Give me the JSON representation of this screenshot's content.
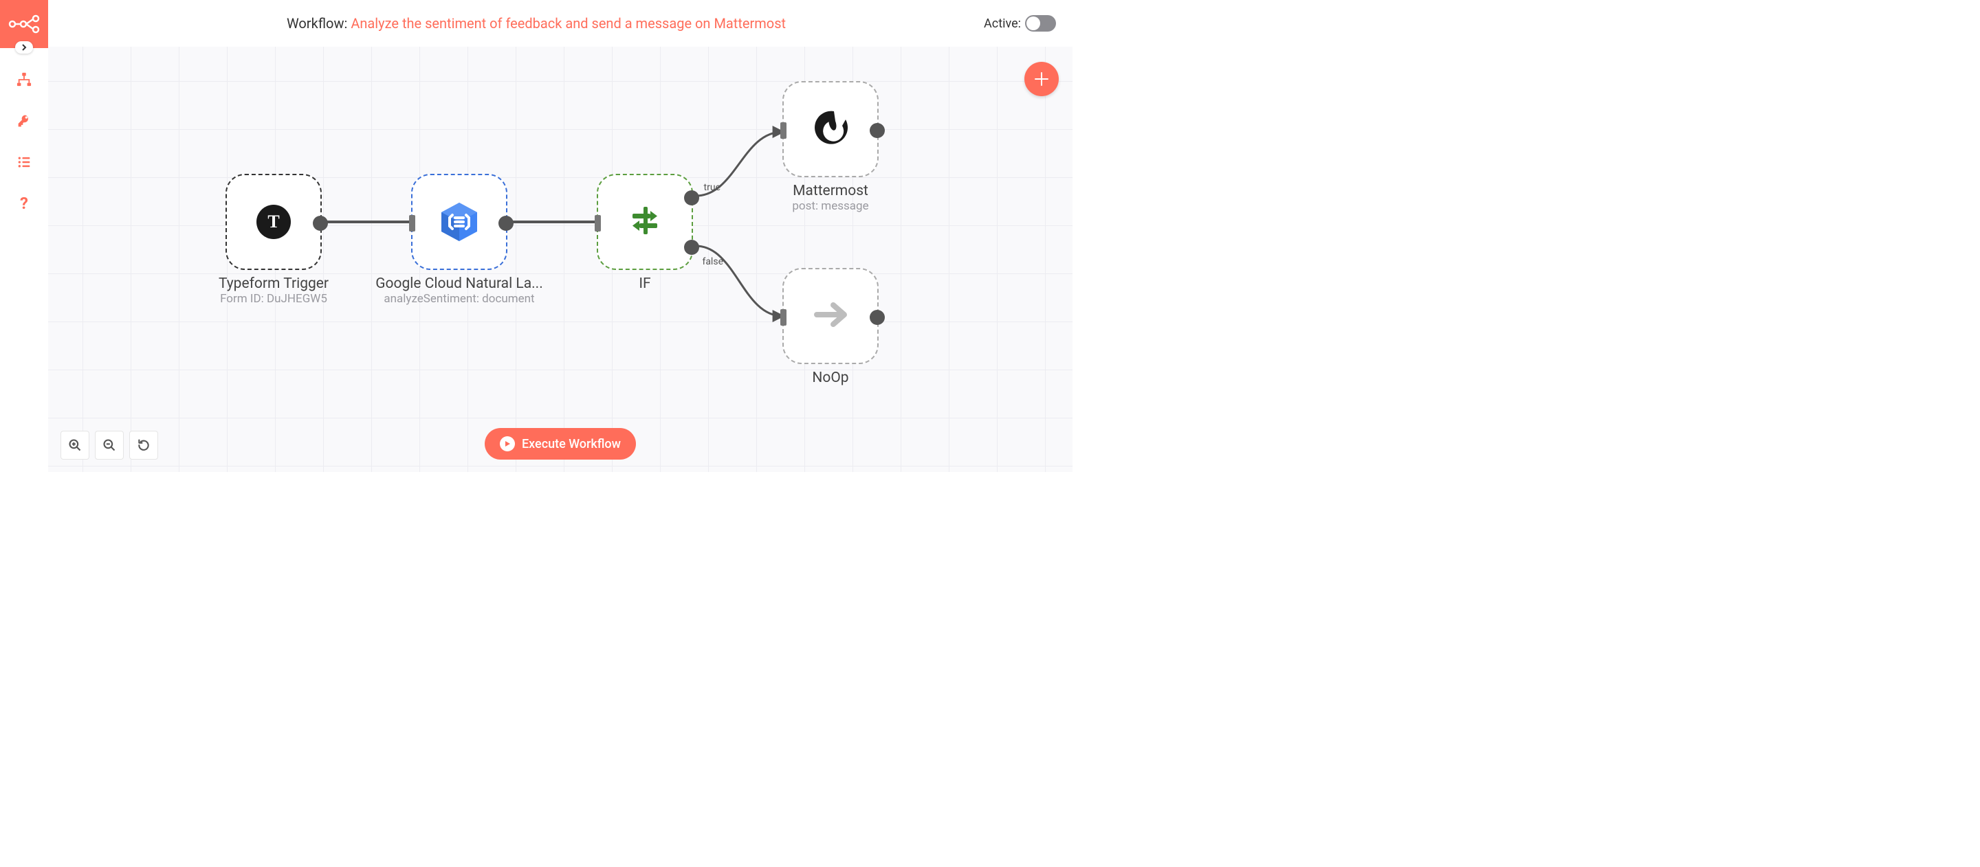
{
  "header": {
    "prefix": "Workflow:",
    "workflow_name": "Analyze the sentiment of feedback and send a message on Mattermost",
    "active_label": "Active:",
    "active": false
  },
  "sidebar": {
    "items": [
      "workflows",
      "credentials",
      "executions",
      "help"
    ]
  },
  "nodes": {
    "typeform": {
      "title": "Typeform Trigger",
      "subtitle": "Form ID: DuJHEGW5",
      "icon_letter": "T"
    },
    "google": {
      "title": "Google Cloud Natural La...",
      "subtitle": "analyzeSentiment: document"
    },
    "if": {
      "title": "IF",
      "out_true": "true",
      "out_false": "false"
    },
    "mattermost": {
      "title": "Mattermost",
      "subtitle": "post: message"
    },
    "noop": {
      "title": "NoOp"
    }
  },
  "buttons": {
    "execute": "Execute Workflow"
  }
}
